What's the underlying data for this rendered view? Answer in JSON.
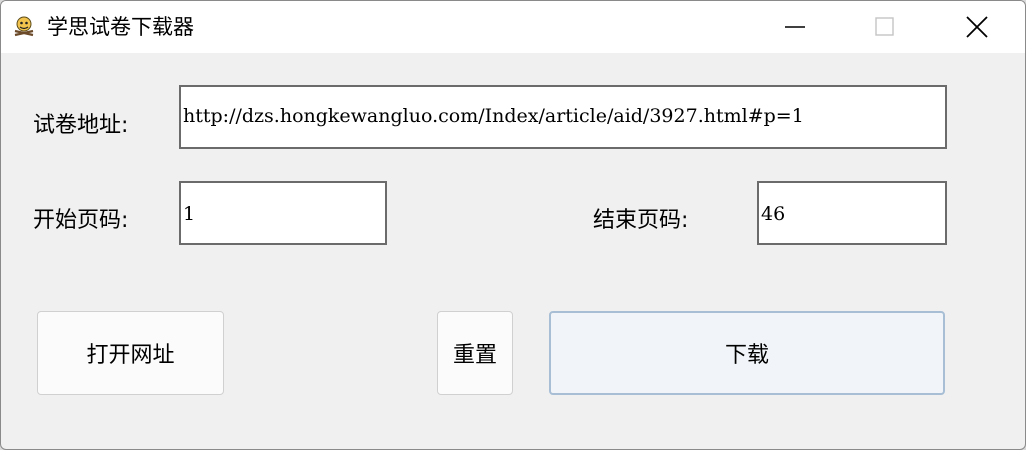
{
  "window": {
    "title": "学思试卷下载器",
    "icons": {
      "app": "app-icon",
      "minimize": "minimize-icon",
      "maximize": "maximize-icon",
      "close": "close-icon"
    }
  },
  "form": {
    "url_label": "试卷地址:",
    "url_value": "http://dzs.hongkewangluo.com/Index/article/aid/3927.html#p=1",
    "start_label": "开始页码:",
    "start_value": "1",
    "end_label": "结束页码:",
    "end_value": "46"
  },
  "buttons": {
    "open_url": "打开网址",
    "reset": "重置",
    "download": "下载"
  }
}
